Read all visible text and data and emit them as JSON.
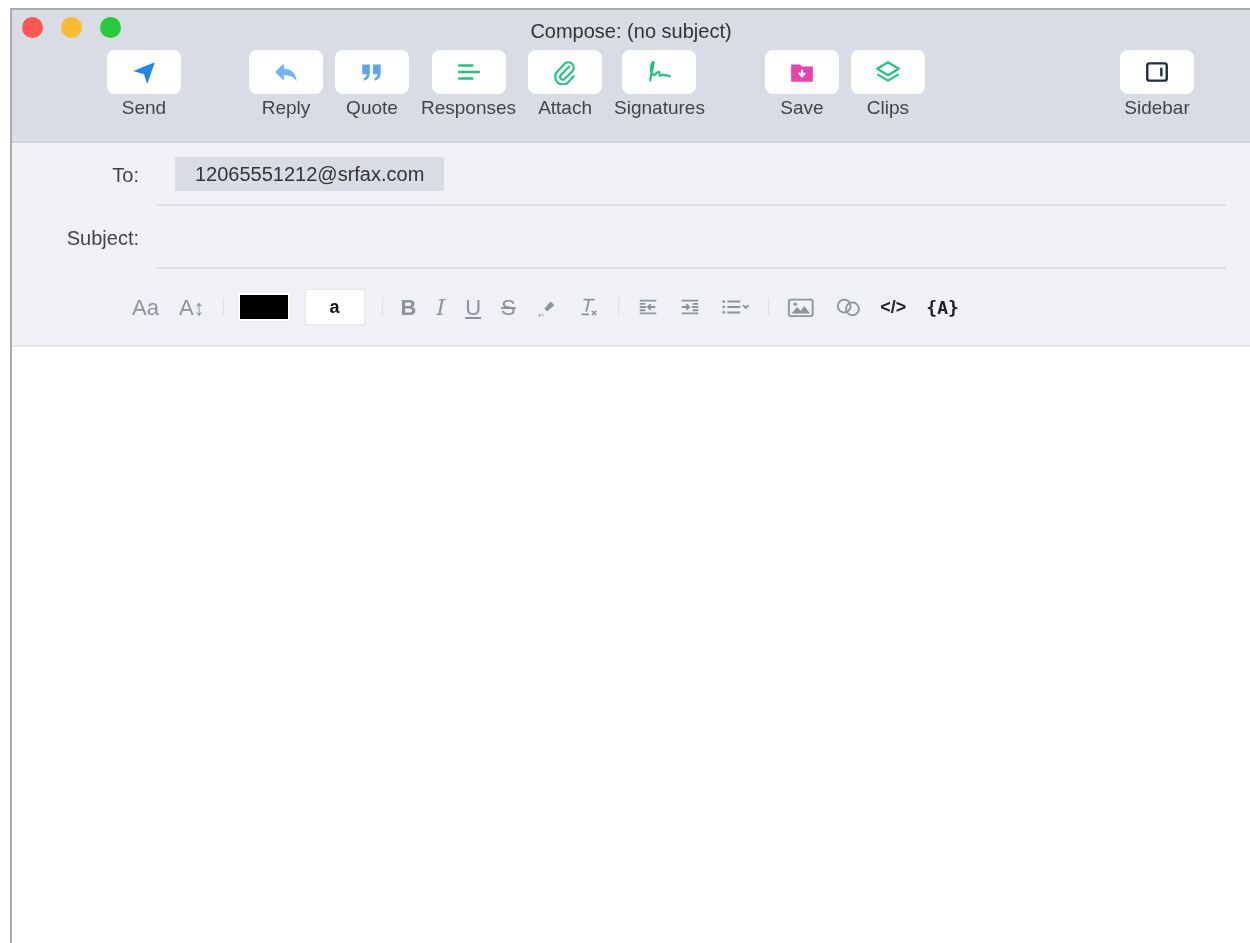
{
  "window": {
    "title": "Compose: (no subject)"
  },
  "toolbar": [
    {
      "buttons": [
        {
          "label": "Send",
          "kind": "send"
        }
      ]
    },
    {
      "buttons": [
        {
          "label": "Reply",
          "kind": "reply"
        },
        {
          "label": "Quote",
          "kind": "quote"
        },
        {
          "label": "Responses",
          "kind": "responses"
        },
        {
          "label": "Attach",
          "kind": "attach"
        },
        {
          "label": "Signatures",
          "kind": "signature"
        }
      ]
    },
    {
      "buttons": [
        {
          "label": "Save",
          "kind": "save"
        },
        {
          "label": "Clips",
          "kind": "clips"
        }
      ]
    },
    {
      "buttons": [
        {
          "label": "Sidebar",
          "kind": "sidebar"
        }
      ]
    }
  ],
  "fields": [
    {
      "label": "To:",
      "recipients": [
        "12065551212@srfax.com"
      ]
    },
    {
      "label": "Subject:"
    }
  ],
  "format_tools": [
    {
      "kind": "font",
      "text": "Aa"
    },
    {
      "kind": "size",
      "text": "A↕"
    },
    {
      "kind": "divider"
    },
    {
      "kind": "text_color",
      "color": "#000000"
    },
    {
      "kind": "background_color",
      "text": "a"
    },
    {
      "kind": "divider"
    },
    {
      "kind": "bold",
      "text": "B"
    },
    {
      "kind": "italic",
      "text": "I"
    },
    {
      "kind": "underline",
      "text": "U"
    },
    {
      "kind": "strike",
      "text": "S"
    },
    {
      "kind": "highlight"
    },
    {
      "kind": "clear"
    },
    {
      "kind": "divider"
    },
    {
      "kind": "outdent"
    },
    {
      "kind": "indent"
    },
    {
      "kind": "list"
    },
    {
      "kind": "divider"
    },
    {
      "kind": "image"
    },
    {
      "kind": "link"
    },
    {
      "kind": "code",
      "text": "</>"
    },
    {
      "kind": "variable",
      "text": "{A}"
    }
  ]
}
